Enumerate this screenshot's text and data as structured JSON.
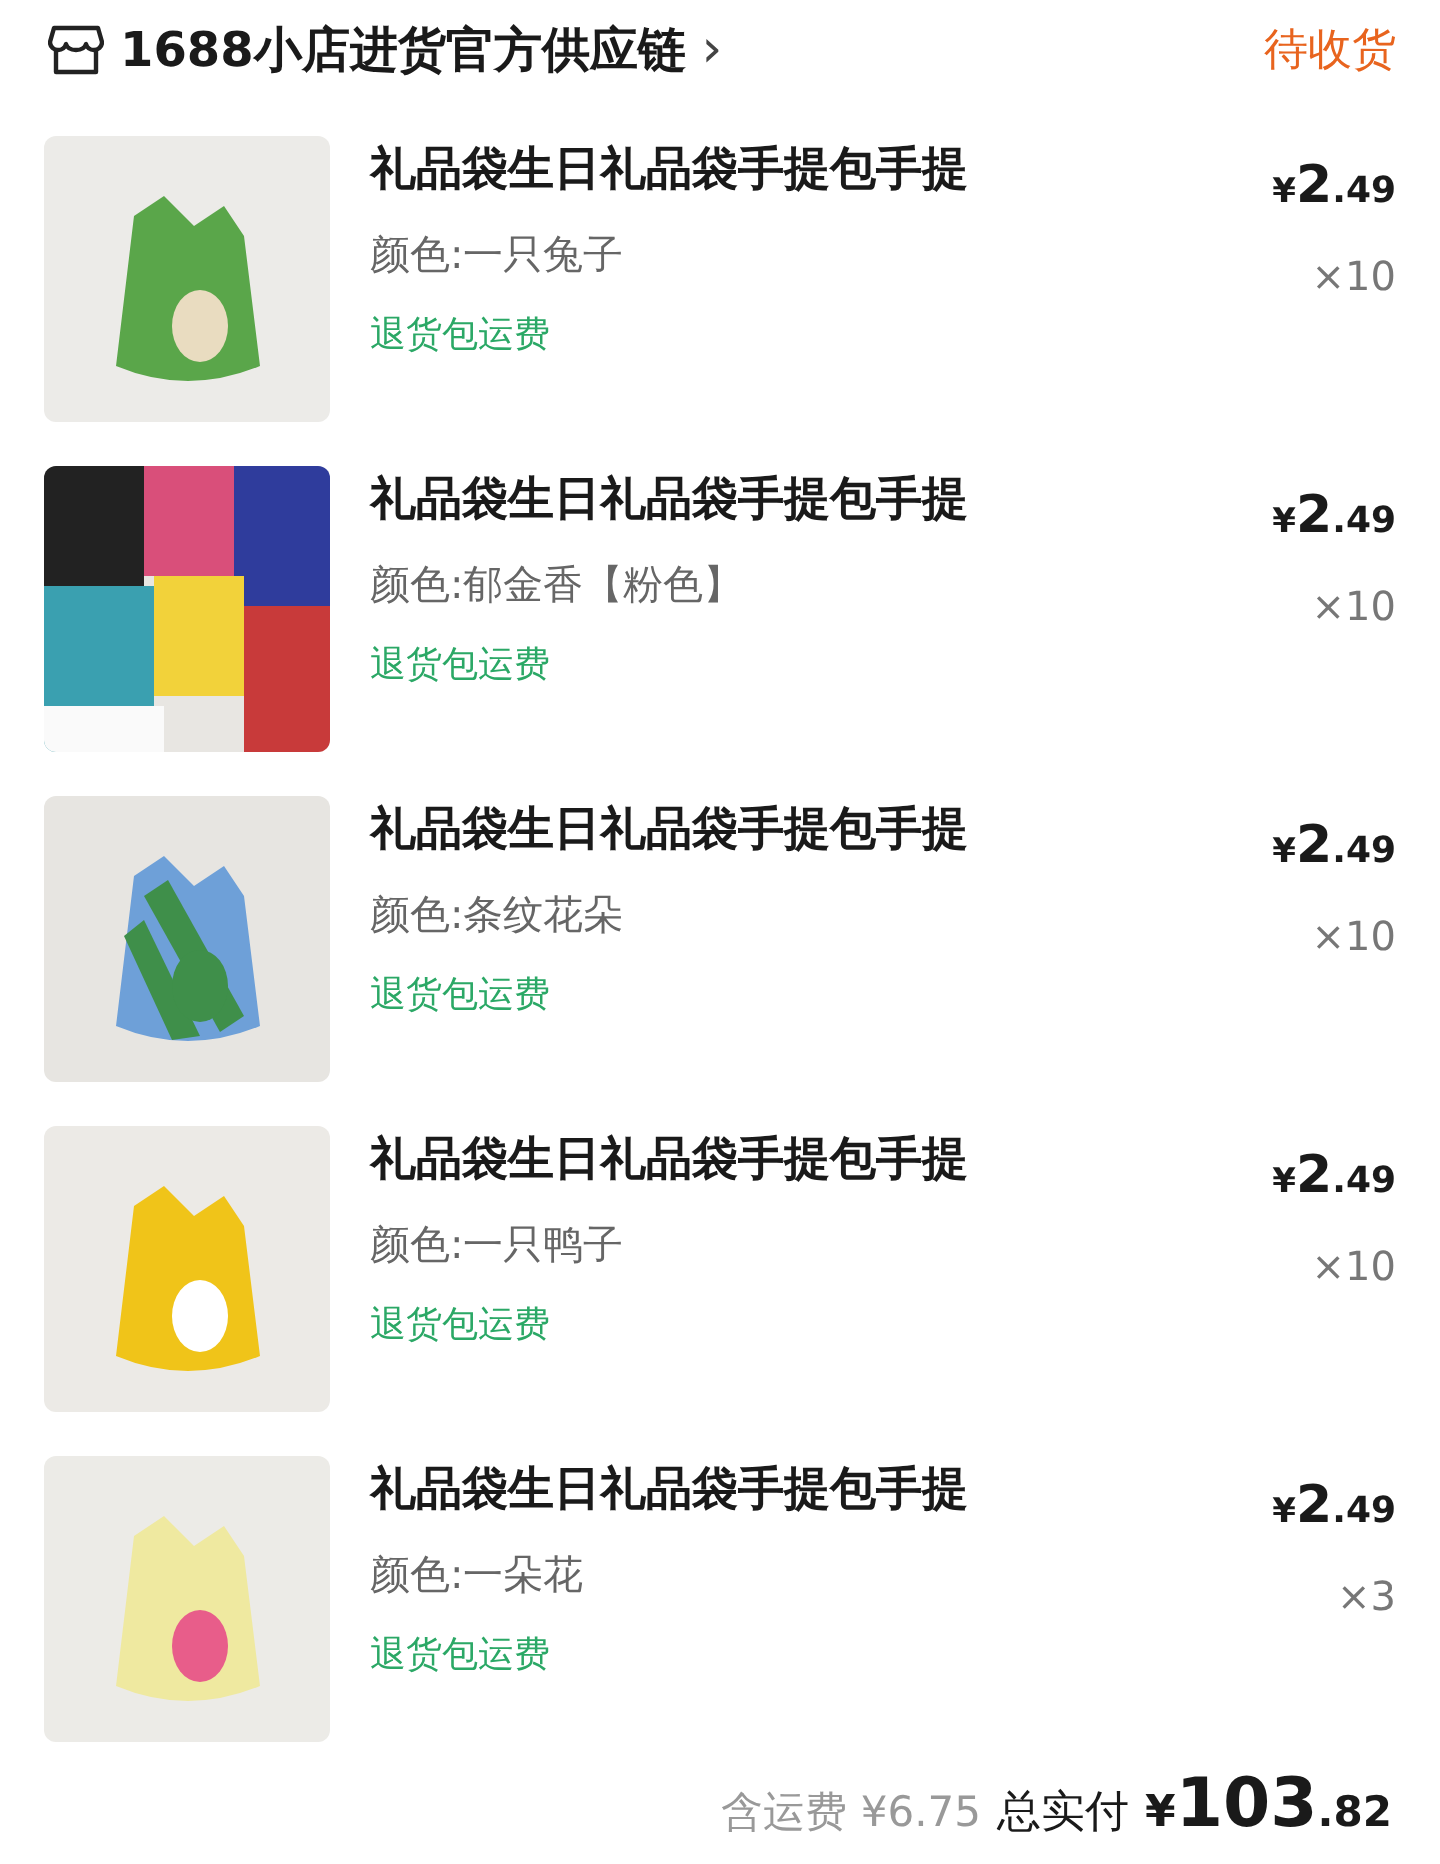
{
  "shop": {
    "name": "1688小店进货官方供应链",
    "chevron": "›",
    "status": "待收货"
  },
  "items": [
    {
      "title": "礼品袋生日礼品袋手提包手提",
      "variant": "颜色:一只兔子",
      "tag": "退货包运费",
      "currency": "¥",
      "price_int": "2",
      "price_dec": ".49",
      "quantity": "×10"
    },
    {
      "title": "礼品袋生日礼品袋手提包手提",
      "variant": "颜色:郁金香【粉色】",
      "tag": "退货包运费",
      "currency": "¥",
      "price_int": "2",
      "price_dec": ".49",
      "quantity": "×10"
    },
    {
      "title": "礼品袋生日礼品袋手提包手提",
      "variant": "颜色:条纹花朵",
      "tag": "退货包运费",
      "currency": "¥",
      "price_int": "2",
      "price_dec": ".49",
      "quantity": "×10"
    },
    {
      "title": "礼品袋生日礼品袋手提包手提",
      "variant": "颜色:一只鸭子",
      "tag": "退货包运费",
      "currency": "¥",
      "price_int": "2",
      "price_dec": ".49",
      "quantity": "×10"
    },
    {
      "title": "礼品袋生日礼品袋手提包手提",
      "variant": "颜色:一朵花",
      "tag": "退货包运费",
      "currency": "¥",
      "price_int": "2",
      "price_dec": ".49",
      "quantity": "×3"
    }
  ],
  "footer": {
    "shipping": "含运费 ¥6.75",
    "total_label": "总实付",
    "currency": "¥",
    "total_int": "103",
    "total_dec": ".82"
  }
}
